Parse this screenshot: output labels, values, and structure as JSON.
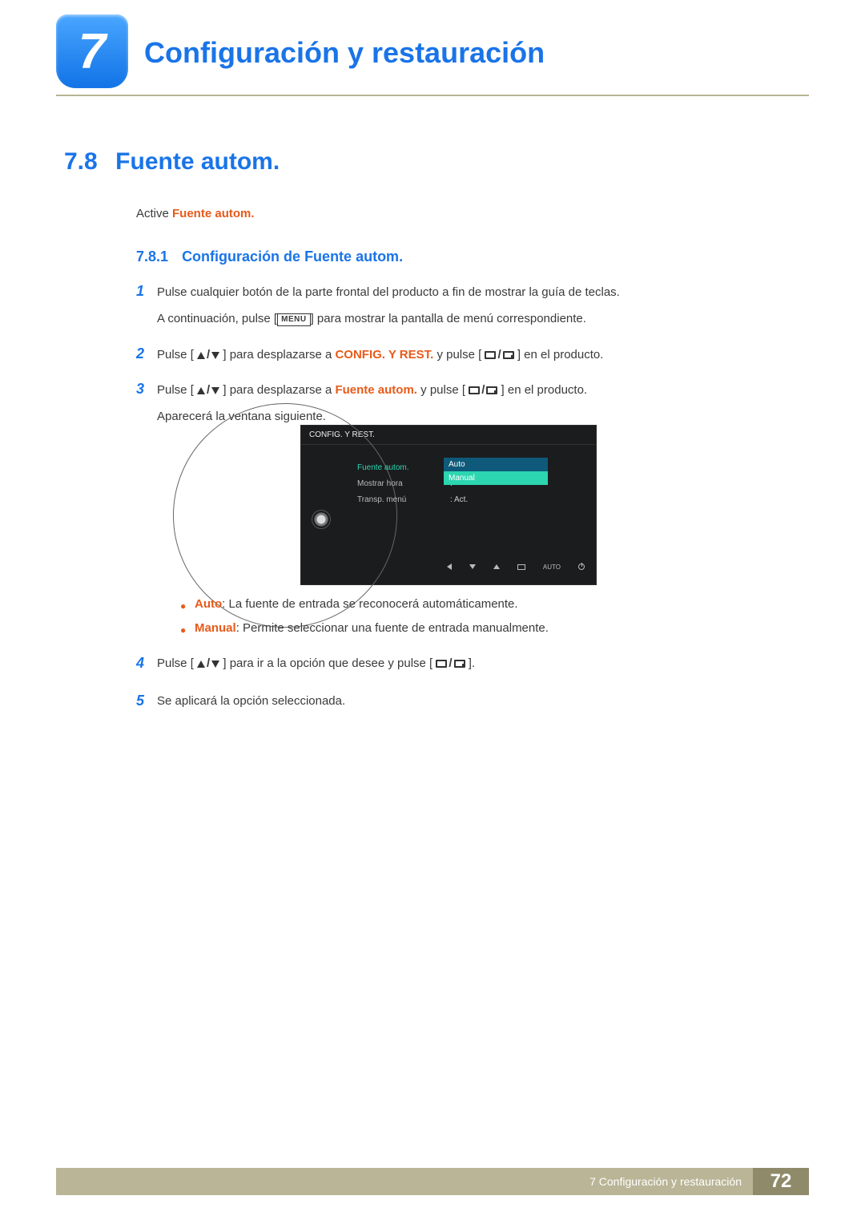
{
  "chapter": {
    "number": "7",
    "title": "Configuración y restauración"
  },
  "section": {
    "number": "7.8",
    "title": "Fuente autom."
  },
  "intro": {
    "prefix": "Active ",
    "highlight": "Fuente autom."
  },
  "subsection": {
    "number": "7.8.1",
    "title": "Configuración de Fuente autom."
  },
  "steps": {
    "s1": {
      "num": "1",
      "line1": "Pulse cualquier botón de la parte frontal del producto a fin de mostrar la guía de teclas.",
      "line2a": "A continuación, pulse [",
      "menu_label": "MENU",
      "line2b": "] para mostrar la pantalla de menú correspondiente."
    },
    "s2": {
      "num": "2",
      "pre": "Pulse [",
      "mid1": "] para desplazarse a ",
      "target": "CONFIG. Y REST.",
      "mid2": " y pulse [",
      "post": "] en el producto."
    },
    "s3": {
      "num": "3",
      "pre": "Pulse [",
      "mid1": "] para desplazarse a ",
      "target": "Fuente autom.",
      "mid2": " y pulse [",
      "post": "] en el producto.",
      "after": "Aparecerá la ventana siguiente."
    },
    "s4": {
      "num": "4",
      "pre": "Pulse [",
      "mid": "] para ir a la opción que desee y pulse [",
      "post": "]."
    },
    "s5": {
      "num": "5",
      "text": "Se aplicará la opción seleccionada."
    }
  },
  "osd": {
    "title": "CONFIG. Y REST.",
    "items": [
      {
        "label": "Fuente autom.",
        "value": ""
      },
      {
        "label": "Mostrar hora",
        "value": ""
      },
      {
        "label": "Transp. menú",
        "value": "Act."
      }
    ],
    "dropdown": {
      "opt1": "Auto",
      "opt2": "Manual"
    },
    "bottom_auto": "AUTO"
  },
  "bullets": {
    "b1": {
      "term": "Auto",
      "text": ": La fuente de entrada se reconocerá automáticamente."
    },
    "b2": {
      "term": "Manual",
      "text": ": Permite seleccionar una fuente de entrada manualmente."
    }
  },
  "footer": {
    "chapter_line": "7 Configuración y restauración",
    "page": "72"
  }
}
